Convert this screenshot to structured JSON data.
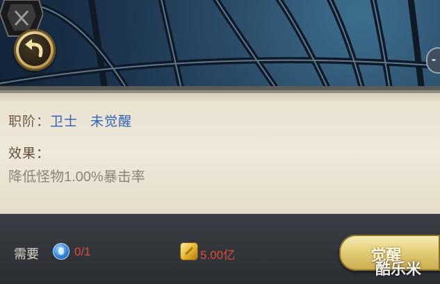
{
  "header": {
    "back_icon": "back-arrow-icon",
    "badge_icon": "character-badge-icon",
    "side_button_label": "-"
  },
  "info": {
    "class_label": "职阶：",
    "class_value": "卫士",
    "awaken_status": "未觉醒",
    "effect_label": "效果：",
    "effect_text": "降低怪物1.00%暴击率"
  },
  "footer": {
    "need_label": "需要",
    "item_icon": "blue-gem-icon",
    "item_count": "0/1",
    "gold_icon": "gold-coin-icon",
    "gold_cost": "5.00亿",
    "awaken_button": "觉醒"
  },
  "watermark": "酷乐米",
  "colors": {
    "class_value": "#2f62b8",
    "cost_red": "#e04a3a",
    "parchment": "#efe9da",
    "button_gold": "#e4cf7a"
  }
}
